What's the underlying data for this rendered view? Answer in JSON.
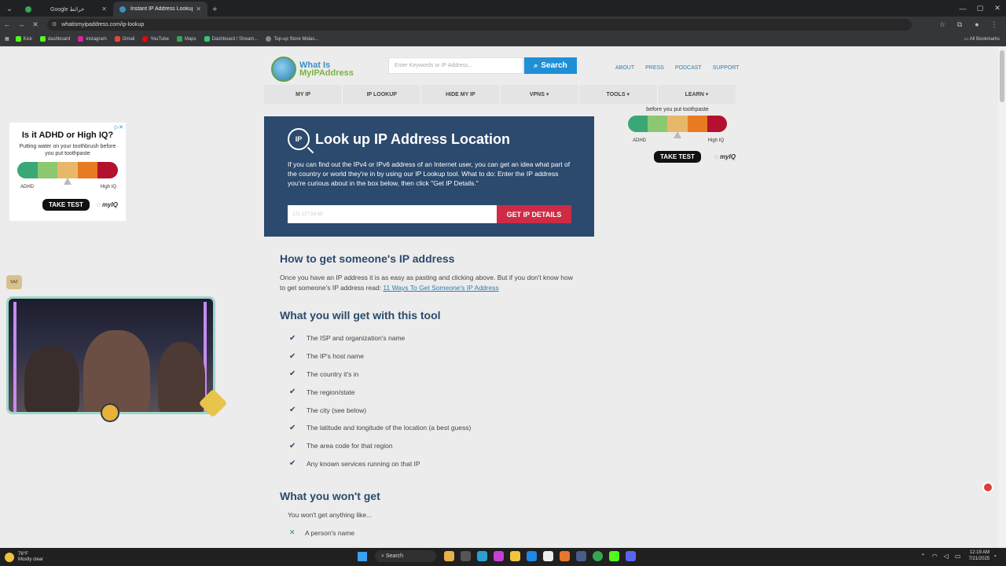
{
  "browser": {
    "tabs": [
      {
        "title": "Google خرائط",
        "active": false
      },
      {
        "title": "Instant IP Address Lookup",
        "active": true
      }
    ],
    "url": "whatismyipaddress.com/ip-lookup",
    "bookmarks": [
      "Kick",
      "dashboard",
      "instagram",
      "Gmail",
      "YouTube",
      "Maps",
      "Dashboard / Stream...",
      "Top-up Store Midas..."
    ],
    "all_bookmarks": "All Bookmarks"
  },
  "site": {
    "logo_line1": "What Is",
    "logo_line2": "MyIPAddress",
    "search_placeholder": "Enter Keywords or IP Address...",
    "search_button": "Search",
    "top_links": [
      "ABOUT",
      "PRESS",
      "PODCAST",
      "SUPPORT"
    ],
    "nav": [
      "MY IP",
      "IP LOOKUP",
      "HIDE MY IP",
      "VPNS ▾",
      "TOOLS ▾",
      "LEARN ▾"
    ]
  },
  "ad_right": {
    "caption": "before you put toothpaste",
    "left_label": "ADHD",
    "right_label": "High IQ",
    "button": "TAKE TEST",
    "brand": "myIQ"
  },
  "ad_left": {
    "headline": "Is it ADHD or High IQ?",
    "caption": "Putting water on your toothbrush before you put toothpaste",
    "left_label": "ADHD",
    "right_label": "High IQ",
    "button": "TAKE TEST",
    "brand": "myIQ"
  },
  "hero": {
    "icon_text": "IP",
    "title": "Look up IP Address Location",
    "description": "If you can find out the IPv4 or IPv6 address of an Internet user, you can get an idea what part of the country or world they're in by using our IP Lookup tool. What to do: Enter the IP address you're curious about in the box below, then click \"Get IP Details.\"",
    "input_placeholder": "121.127.58.69",
    "button": "GET IP DETAILS"
  },
  "content": {
    "h_how": "How to get someone's IP address",
    "how_text": "Once you have an IP address it is as easy as pasting and clicking above. But if you don't know how to get someone's IP address read: ",
    "how_link": "11 Ways To Get Someone's IP Address",
    "h_get": "What you will get with this tool",
    "features": [
      "The ISP and organization's name",
      "The IP's host name",
      "The country it's in",
      "The region/state",
      "The city (see below)",
      "The latitude and longitude of the location (a best guess)",
      "The area code for that region",
      "Any known services running on that IP"
    ],
    "h_wont": "What you won't get",
    "wont_text": "You won't get anything like...",
    "wont_items": [
      "A person's name"
    ]
  },
  "webcam": {
    "badge": "SAZ"
  },
  "taskbar": {
    "temp": "78°F",
    "weather": "Mostly clear",
    "search": "Search",
    "time": "12:19 AM",
    "date": "7/21/2025"
  },
  "colors": {
    "hero_bg": "#2b4a6d",
    "accent_red": "#cf2b45",
    "search_blue": "#1f8fd6",
    "scale": [
      "#3aa876",
      "#8cc870",
      "#e8b86a",
      "#e87a22",
      "#b3112f"
    ]
  }
}
